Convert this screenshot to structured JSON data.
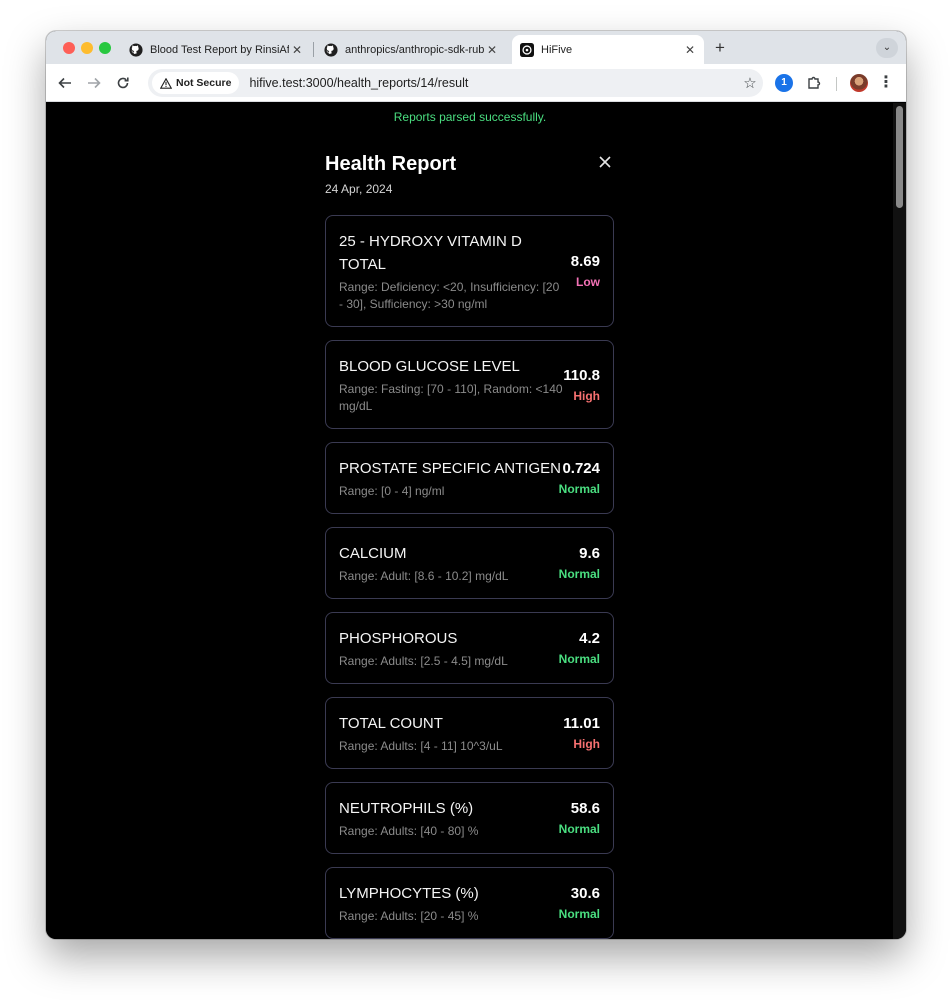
{
  "browser": {
    "tabs": [
      {
        "title": "Blood Test Report by RinsiAfs",
        "icon": "github-icon"
      },
      {
        "title": "anthropics/anthropic-sdk-ruby",
        "icon": "github-icon"
      },
      {
        "title": "HiFive",
        "icon": "hifive-icon",
        "active": true
      }
    ],
    "new_tab": "+",
    "security_label": "Not Secure",
    "url": "hifive.test:3000/health_reports/14/result"
  },
  "page": {
    "flash": "Reports parsed successfully.",
    "title": "Health Report",
    "date": "24 Apr, 2024",
    "results": [
      {
        "name": "25 - HYDROXY VITAMIN D TOTAL",
        "range": "Range: Deficiency: <20, Insufficiency: [20 - 30], Sufficiency: >30 ng/ml",
        "value": "8.69",
        "status": "Low"
      },
      {
        "name": "BLOOD GLUCOSE LEVEL",
        "range": "Range: Fasting: [70 - 110], Random: <140 mg/dL",
        "value": "110.8",
        "status": "High"
      },
      {
        "name": "PROSTATE SPECIFIC ANTIGEN",
        "range": "Range: [0 - 4] ng/ml",
        "value": "0.724",
        "status": "Normal"
      },
      {
        "name": "CALCIUM",
        "range": "Range: Adult: [8.6 - 10.2] mg/dL",
        "value": "9.6",
        "status": "Normal"
      },
      {
        "name": "PHOSPHOROUS",
        "range": "Range: Adults: [2.5 - 4.5] mg/dL",
        "value": "4.2",
        "status": "Normal"
      },
      {
        "name": "TOTAL COUNT",
        "range": "Range: Adults: [4 - 11] 10^3/uL",
        "value": "11.01",
        "status": "High"
      },
      {
        "name": "NEUTROPHILS (%)",
        "range": "Range: Adults: [40 - 80] %",
        "value": "58.6",
        "status": "Normal"
      },
      {
        "name": "LYMPHOCYTES (%)",
        "range": "Range: Adults: [20 - 45] %",
        "value": "30.6",
        "status": "Normal"
      }
    ]
  },
  "colors": {
    "low": "#f472b6",
    "high": "#f87171",
    "normal": "#4ade80",
    "success": "#4ade80"
  }
}
